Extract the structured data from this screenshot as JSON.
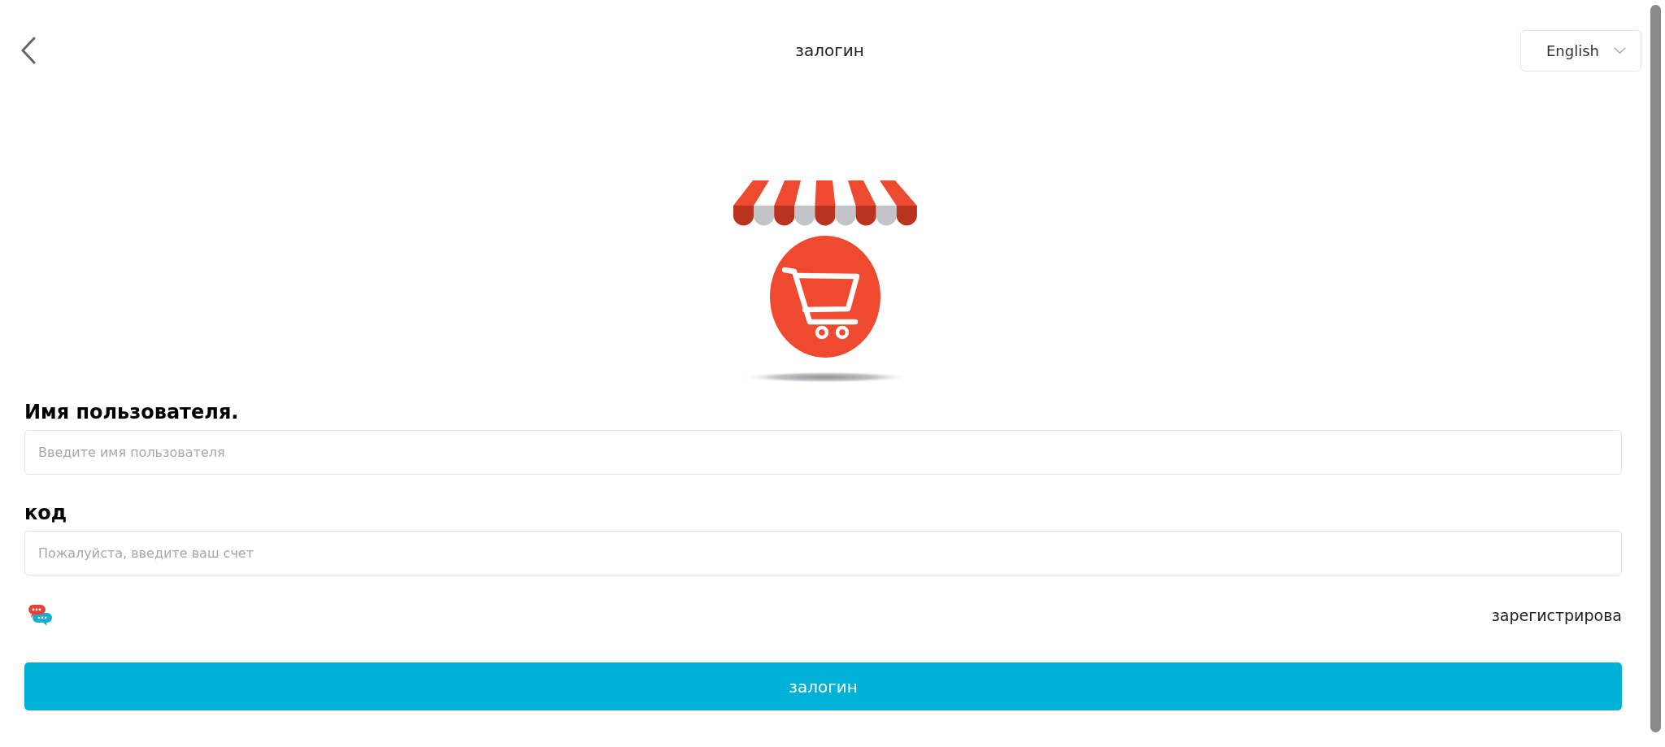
{
  "header": {
    "title": "залогин",
    "language": "English"
  },
  "form": {
    "fields": [
      {
        "label": "Имя пользователя.",
        "placeholder": "Введите имя пользователя"
      },
      {
        "label": "код",
        "placeholder": "Пожалуйста, введите ваш счет"
      }
    ]
  },
  "register_link": "зарегистрирова",
  "submit_button": "залогин"
}
